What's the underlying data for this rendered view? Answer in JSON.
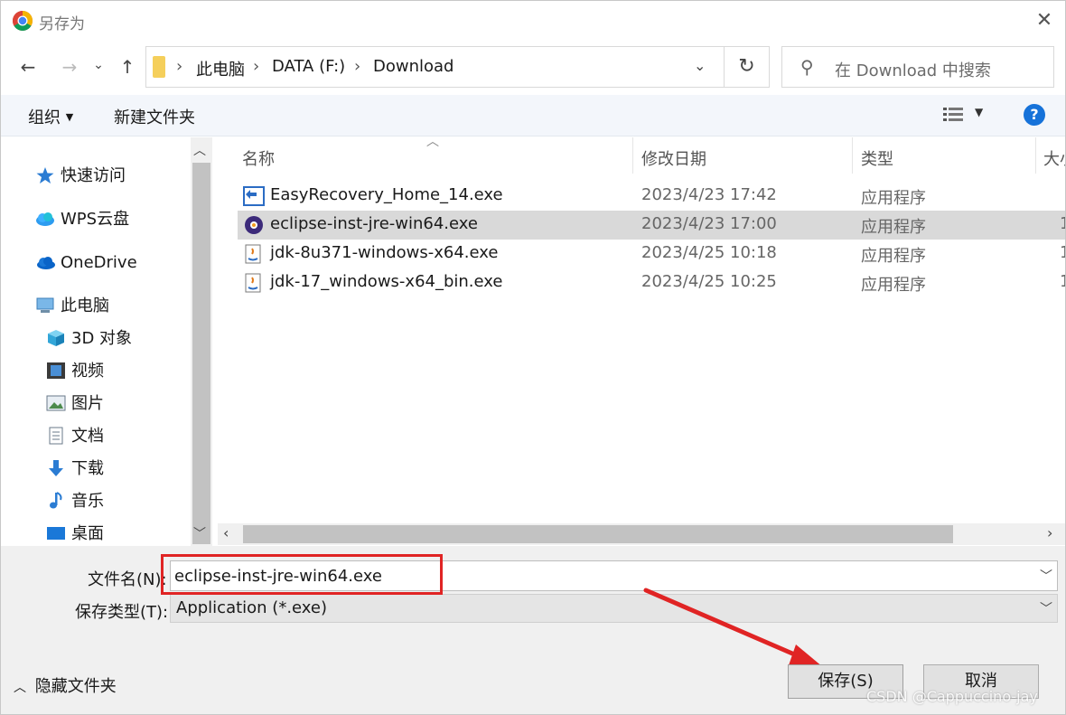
{
  "window": {
    "title": "另存为"
  },
  "nav": {
    "back": "←",
    "forward": "→",
    "recent": "⌄",
    "up": "↑",
    "refresh": "↻"
  },
  "address": {
    "crumbs": [
      "此电脑",
      "DATA (F:)",
      "Download"
    ]
  },
  "search": {
    "placeholder": "在 Download 中搜索"
  },
  "toolbar": {
    "organize": "组织",
    "new_folder": "新建文件夹",
    "help": "?"
  },
  "sidebar": {
    "items": [
      {
        "label": "快速访问",
        "icon": "star-icon"
      },
      {
        "label": "WPS云盘",
        "icon": "cloud-icon"
      },
      {
        "label": "OneDrive",
        "icon": "onedrive-icon"
      },
      {
        "label": "此电脑",
        "icon": "computer-icon"
      },
      {
        "label": "3D 对象",
        "icon": "cube-icon"
      },
      {
        "label": "视频",
        "icon": "video-icon"
      },
      {
        "label": "图片",
        "icon": "picture-icon"
      },
      {
        "label": "文档",
        "icon": "document-icon"
      },
      {
        "label": "下载",
        "icon": "download-icon"
      },
      {
        "label": "音乐",
        "icon": "music-icon"
      },
      {
        "label": "桌面",
        "icon": "desktop-icon"
      }
    ]
  },
  "columns": {
    "name": "名称",
    "modified": "修改日期",
    "type": "类型",
    "size": "大小"
  },
  "files": [
    {
      "name": "EasyRecovery_Home_14.exe",
      "modified": "2023/4/23 17:42",
      "type": "应用程序",
      "size": ""
    },
    {
      "name": "eclipse-inst-jre-win64.exe",
      "modified": "2023/4/23 17:00",
      "type": "应用程序",
      "size": "1"
    },
    {
      "name": "jdk-8u371-windows-x64.exe",
      "modified": "2023/4/25 10:18",
      "type": "应用程序",
      "size": "1"
    },
    {
      "name": "jdk-17_windows-x64_bin.exe",
      "modified": "2023/4/25 10:25",
      "type": "应用程序",
      "size": "1"
    }
  ],
  "form": {
    "filename_label": "文件名(N):",
    "filename_value": "eclipse-inst-jre-win64.exe",
    "filetype_label": "保存类型(T):",
    "filetype_value": "Application (*.exe)"
  },
  "footer": {
    "hide_folders": "隐藏文件夹",
    "save": "保存(S)",
    "cancel": "取消"
  },
  "watermark": "CSDN @Cappuccino-jay",
  "colors": {
    "accent": "#1672d9",
    "selection": "#d9d9d9",
    "highlight": "#e02424"
  }
}
